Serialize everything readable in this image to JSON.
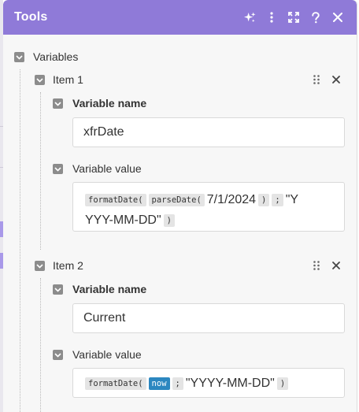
{
  "header": {
    "title": "Tools"
  },
  "icons": [
    "magic-sparkle",
    "more-vertical",
    "expand",
    "help",
    "close"
  ],
  "variables_label": "Variables",
  "items": [
    {
      "label": "Item 1",
      "name_label": "Variable name",
      "name_value": "xfrDate",
      "value_label": "Variable value",
      "value_tokens": {
        "f1": "formatDate(",
        "f2": "parseDate(",
        "t1": "7/1/2024",
        "p1": ")",
        "p2": ";",
        "t2a": "\"Y",
        "t2b": "YYY-MM-DD\"",
        "p3": ")"
      }
    },
    {
      "label": "Item 2",
      "name_label": "Variable name",
      "name_value": "Current",
      "value_label": "Variable value",
      "value_tokens": {
        "f1": "formatDate(",
        "k1": "now",
        "p1": ";",
        "t1": "\"YYYY-MM-DD\"",
        "p2": ")"
      }
    }
  ],
  "colors": {
    "header": "#8f7ad8",
    "checkbox": "#8c8c8c",
    "keyword_pill": "#2c87c0",
    "function_pill": "#e4e4e4"
  }
}
